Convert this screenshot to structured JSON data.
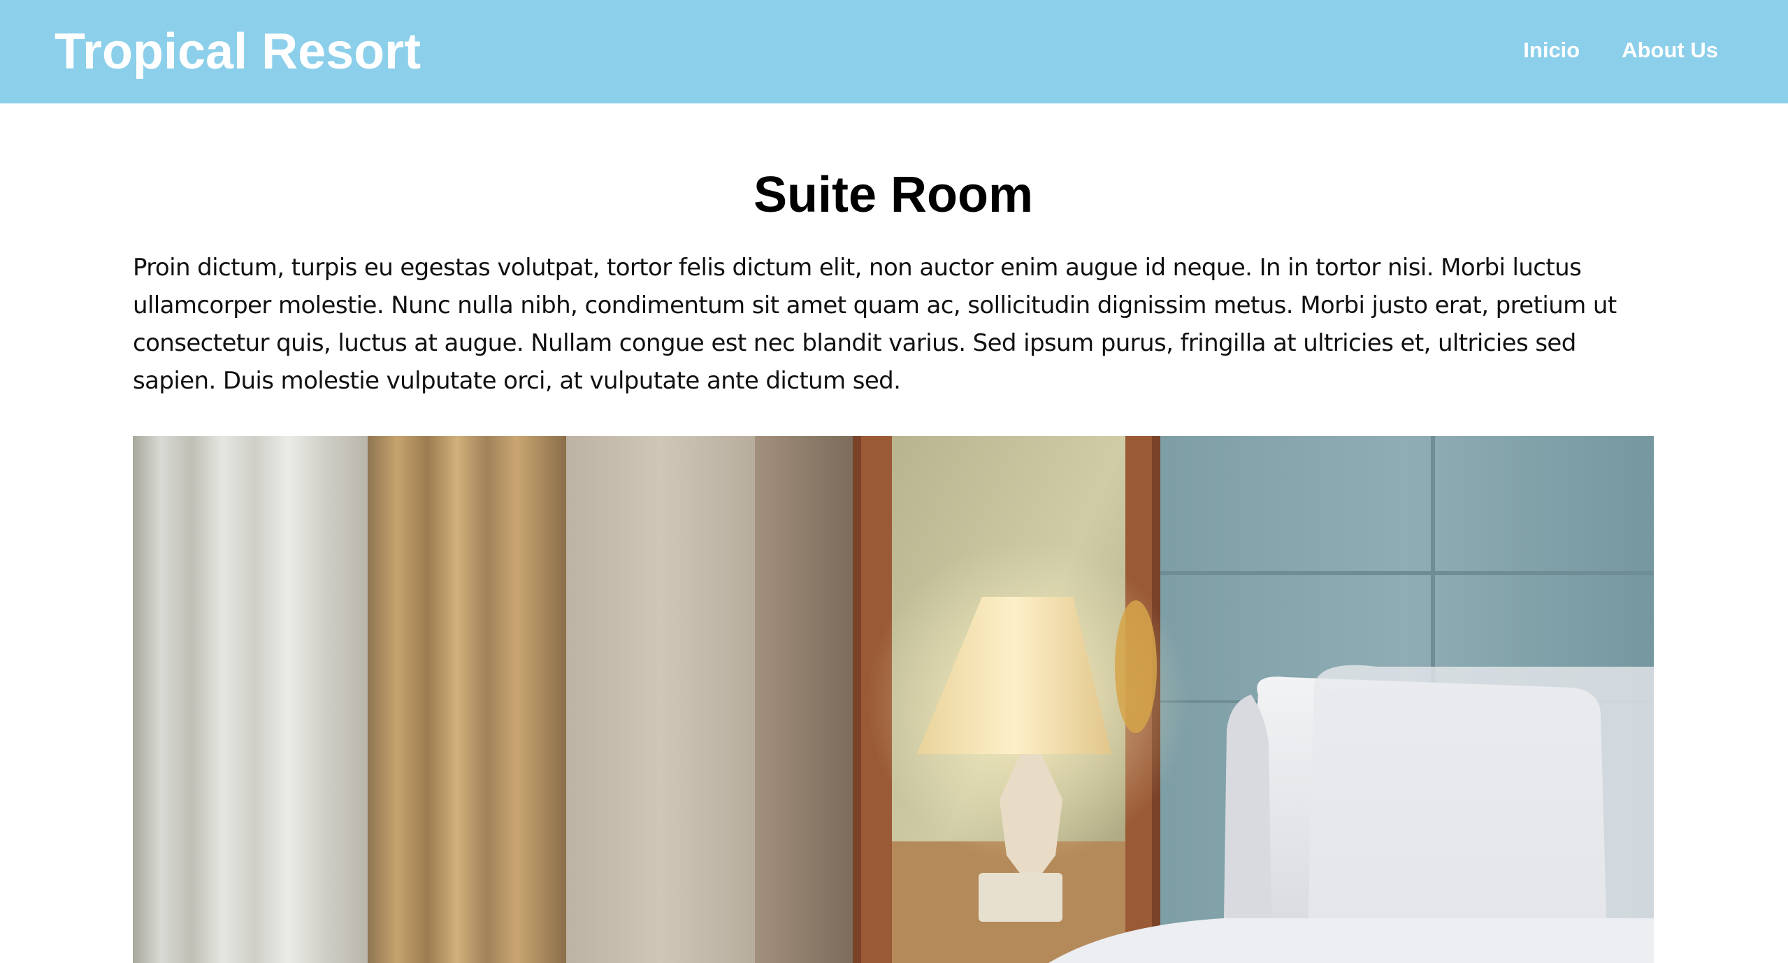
{
  "header": {
    "brand": "Tropical Resort",
    "nav": [
      {
        "label": "Inicio"
      },
      {
        "label": "About Us"
      }
    ],
    "background_color": "#8ccfea"
  },
  "room": {
    "title": "Suite Room",
    "description": "Proin dictum, turpis eu egestas volutpat, tortor felis dictum elit, non auctor enim augue id neque. In in tortor nisi. Morbi luctus ullamcorper molestie. Nunc nulla nibh, condimentum sit amet quam ac, sollicitudin dignissim metus. Morbi justo erat, pretium ut consectetur quis, luctus at augue. Nullam congue est nec blandit varius. Sed ipsum purus, fringilla at ultricies et, ultricies sed sapien. Duis molestie vulputate orci, at vulputate ante dictum sed."
  },
  "photo": {
    "subject": "hotel-bedroom-photo"
  }
}
